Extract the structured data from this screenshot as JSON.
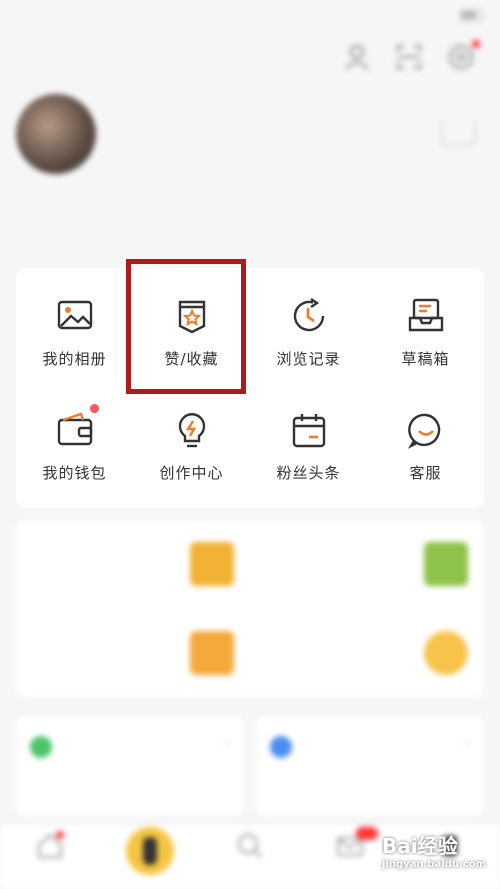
{
  "grid": {
    "items": [
      {
        "label": "我的相册",
        "icon": "photo-album-icon"
      },
      {
        "label": "赞/收藏",
        "icon": "bookmark-star-icon"
      },
      {
        "label": "浏览记录",
        "icon": "history-clock-icon"
      },
      {
        "label": "草稿箱",
        "icon": "draft-box-icon"
      },
      {
        "label": "我的钱包",
        "icon": "wallet-icon",
        "has_dot": true
      },
      {
        "label": "创作中心",
        "icon": "lightbulb-icon"
      },
      {
        "label": "粉丝头条",
        "icon": "calendar-icon"
      },
      {
        "label": "客服",
        "icon": "chat-bubble-icon"
      }
    ]
  },
  "colors": {
    "accent": "#f2a24a",
    "icon_dark": "#333333",
    "icon_orange": "#f07c2b",
    "highlight": "#b11a1a"
  },
  "watermark": {
    "text": "Bai经验",
    "sub": "jingyan.baidu.com"
  }
}
